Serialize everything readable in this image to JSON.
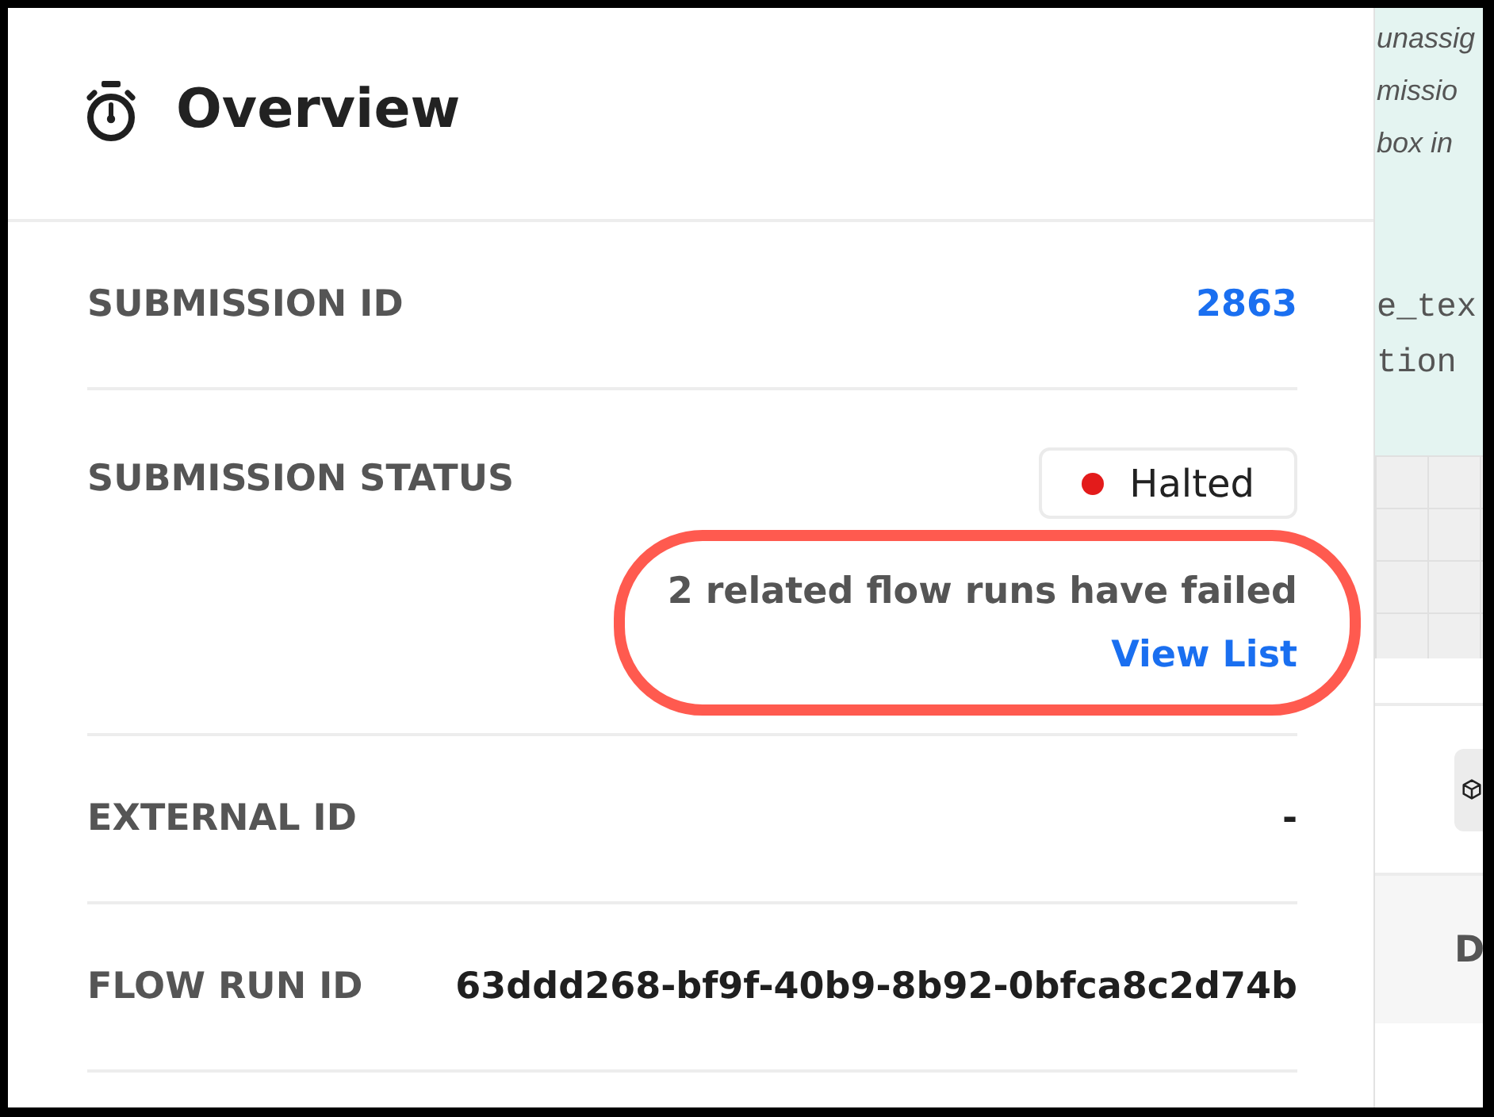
{
  "header": {
    "title": "Overview"
  },
  "fields": [
    {
      "kind": "link",
      "label": "SUBMISSION ID",
      "value": "2863",
      "highlighted": false
    },
    {
      "kind": "status",
      "label": "SUBMISSION STATUS",
      "status": {
        "label": "Halted",
        "color": "#e31b1b"
      },
      "message": "2 related flow runs have failed",
      "link": "View List",
      "highlighted": true
    },
    {
      "kind": "text",
      "label": "EXTERNAL ID",
      "value": "-",
      "highlighted": false
    },
    {
      "kind": "text",
      "label": "FLOW RUN ID",
      "value": "63ddd268-bf9f-40b9-8b92-0bfca8c2d74b",
      "highlighted": false
    }
  ],
  "background_panel": {
    "note_lines": [
      "unassig",
      "missio",
      "box in"
    ],
    "code_lines": [
      "e_tex",
      "tion"
    ],
    "table_header": "D"
  }
}
